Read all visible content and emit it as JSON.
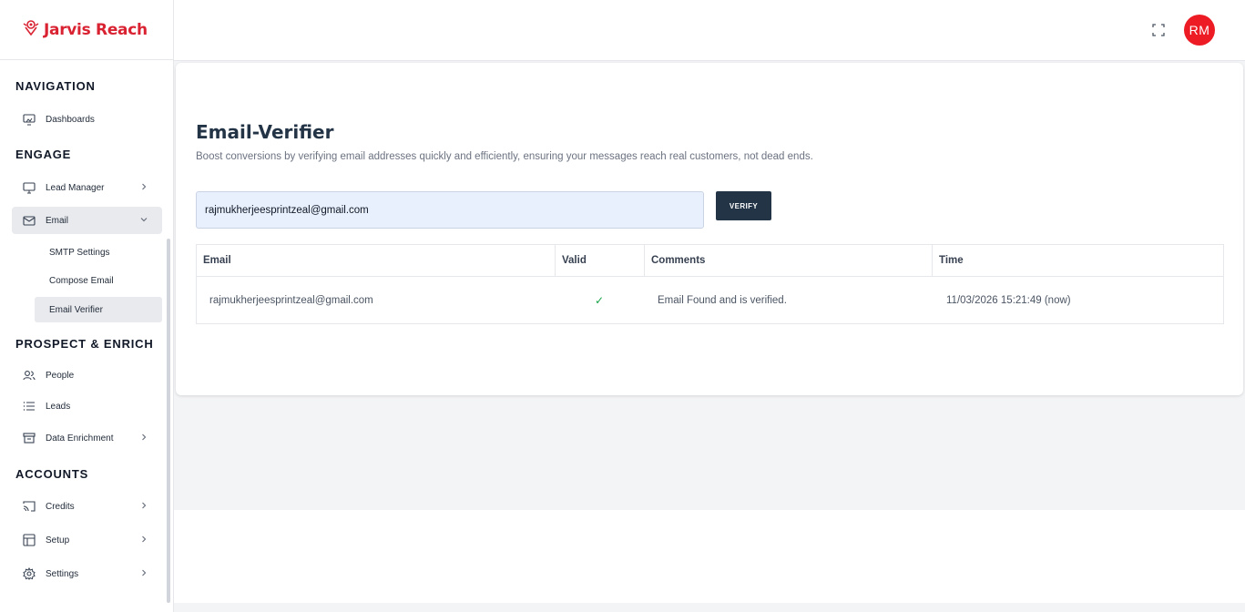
{
  "brand": {
    "name": "Jarvis Reach",
    "color": "#d92332"
  },
  "sidebar": {
    "sections": {
      "navigation": "NAVIGATION",
      "engage": "ENGAGE",
      "prospect": "PROSPECT & ENRICH",
      "accounts": "ACCOUNTS"
    },
    "items": {
      "dashboards": "Dashboards",
      "lead_manager": "Lead Manager",
      "email": "Email",
      "smtp_settings": "SMTP Settings",
      "compose_email": "Compose Email",
      "email_verifier": "Email Verifier",
      "people": "People",
      "leads": "Leads",
      "data_enrichment": "Data Enrichment",
      "credits": "Credits",
      "setup": "Setup",
      "settings": "Settings"
    }
  },
  "header": {
    "avatar_initials": "RM",
    "avatar_color": "#ed1c24"
  },
  "main": {
    "title": "Email-Verifier",
    "subtitle": "Boost conversions by verifying email addresses quickly and efficiently, ensuring your messages reach real customers, not dead ends.",
    "email_value": "rajmukherjeesprintzeal@gmail.com",
    "verify_label": "VERIFY",
    "table": {
      "columns": [
        "Email",
        "Valid",
        "Comments",
        "Time"
      ],
      "rows": [
        {
          "email": "rajmukherjeesprintzeal@gmail.com",
          "valid": "✓",
          "comment": "Email Found and is verified.",
          "time": "11/03/2026 15:21:49 (now)"
        }
      ]
    }
  }
}
